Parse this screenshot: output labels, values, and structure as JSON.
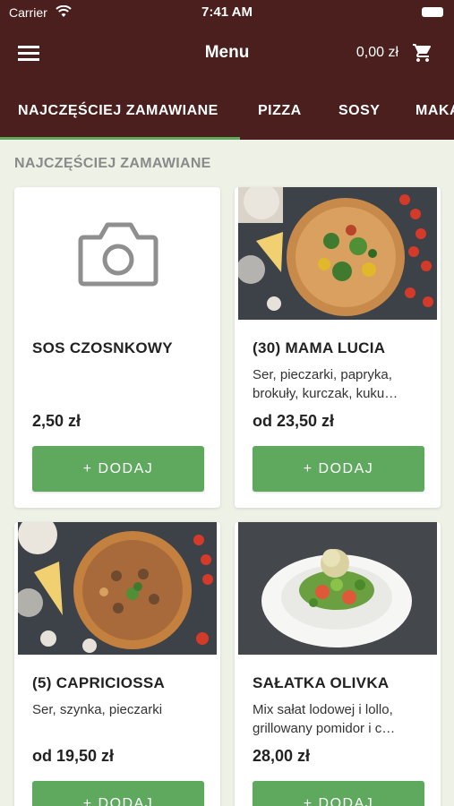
{
  "status_bar": {
    "carrier": "Carrier",
    "time": "7:41 AM"
  },
  "app_bar": {
    "title": "Menu",
    "cart_total": "0,00 zł"
  },
  "tabs": [
    {
      "label": "NAJCZĘŚCIEJ ZAMAWIANE",
      "active": true
    },
    {
      "label": "PIZZA"
    },
    {
      "label": "SOSY"
    },
    {
      "label": "MAKA"
    }
  ],
  "section": {
    "title": "NAJCZĘŚCIEJ ZAMAWIANE"
  },
  "products": [
    {
      "name": "SOS CZOSNKOWY",
      "description": "",
      "price": "2,50 zł",
      "button": "+ DODAJ",
      "image": "camera-placeholder-icon"
    },
    {
      "name": "(30) MAMA LUCIA",
      "description": "Ser, pieczarki, papryka, brokuły, kurczak, kuku…",
      "price": "od 23,50 zł",
      "button": "+ DODAJ",
      "image": "pizza-photo"
    },
    {
      "name": "(5) CAPRICIOSSA",
      "description": "Ser, szynka, pieczarki",
      "price": "od 19,50 zł",
      "button": "+ DODAJ",
      "image": "pizza-photo"
    },
    {
      "name": "SAŁATKA OLIVKA",
      "description": "Mix sałat lodowej i lollo, grillowany pomidor i c…",
      "price": "28,00 zł",
      "button": "+ DODAJ",
      "image": "salad-photo"
    }
  ],
  "colors": {
    "header": "#4a1f1d",
    "accent": "#5fa95f",
    "background": "#eef2e6"
  }
}
